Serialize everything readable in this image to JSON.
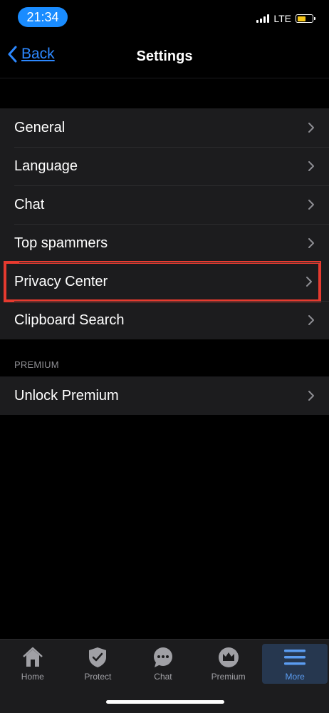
{
  "status_bar": {
    "time": "21:34",
    "network": "LTE",
    "battery_color": "#f5c518"
  },
  "nav": {
    "back_label": "Back",
    "title": "Settings"
  },
  "settings_items": [
    {
      "label": "General"
    },
    {
      "label": "Language"
    },
    {
      "label": "Chat"
    },
    {
      "label": "Top spammers"
    },
    {
      "label": "Privacy Center",
      "highlighted": true
    },
    {
      "label": "Clipboard Search"
    }
  ],
  "premium_section": {
    "header": "PREMIUM",
    "items": [
      {
        "label": "Unlock Premium"
      }
    ]
  },
  "tab_bar": {
    "tabs": [
      {
        "label": "Home",
        "icon": "house-icon"
      },
      {
        "label": "Protect",
        "icon": "shield-check-icon"
      },
      {
        "label": "Chat",
        "icon": "chat-bubble-icon"
      },
      {
        "label": "Premium",
        "icon": "crown-icon"
      },
      {
        "label": "More",
        "icon": "menu-lines-icon",
        "active": true
      }
    ]
  },
  "colors": {
    "accent": "#2c88ff",
    "highlight_border": "#e53a2f",
    "row_background": "#1c1c1e"
  }
}
